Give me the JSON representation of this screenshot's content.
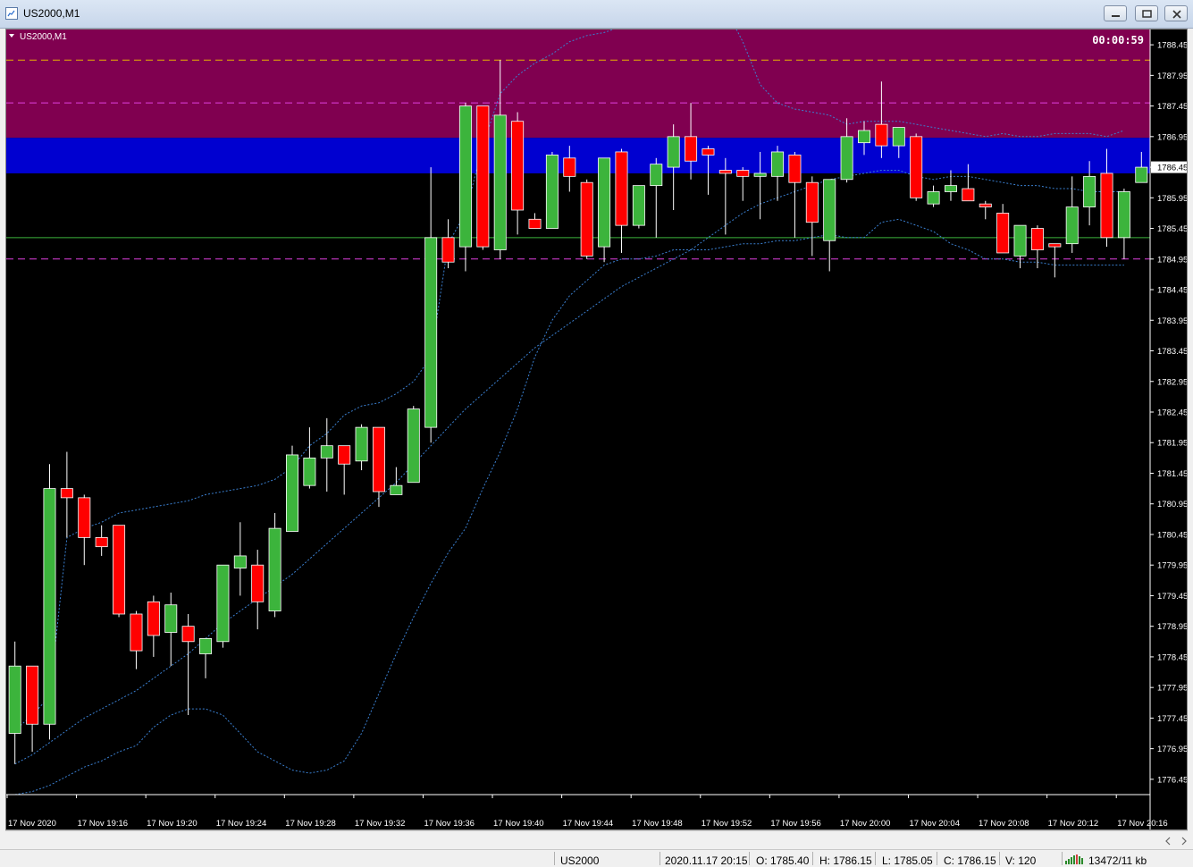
{
  "window": {
    "title": "US2000,M1"
  },
  "chart": {
    "symbol_label": "US2000,M1",
    "timer": "00:00:59",
    "current_price": "1786.45",
    "price_ticks": [
      "1788.45",
      "1787.95",
      "1787.45",
      "1786.95",
      "1786.45",
      "1785.95",
      "1785.45",
      "1784.95",
      "1784.45",
      "1783.95",
      "1783.45",
      "1782.95",
      "1782.45",
      "1781.95",
      "1781.45",
      "1780.95",
      "1780.45",
      "1779.95",
      "1779.45",
      "1778.95",
      "1778.45",
      "1777.95",
      "1777.45",
      "1776.95",
      "1776.45"
    ],
    "time_labels": [
      "17 Nov 2020",
      "17 Nov 19:16",
      "17 Nov 19:20",
      "17 Nov 19:24",
      "17 Nov 19:28",
      "17 Nov 19:32",
      "17 Nov 19:36",
      "17 Nov 19:40",
      "17 Nov 19:44",
      "17 Nov 19:48",
      "17 Nov 19:52",
      "17 Nov 19:56",
      "17 Nov 20:00",
      "17 Nov 20:04",
      "17 Nov 20:08",
      "17 Nov 20:12",
      "17 Nov 20:16"
    ],
    "colors": {
      "background": "#000000",
      "bull": "#3cb43c",
      "bear": "#ff0000",
      "zone_upper": "#800050",
      "zone_lower": "#0000d0",
      "band": "#3a7fd0",
      "text": "#ffffff"
    }
  },
  "chart_data": {
    "type": "candlestick",
    "candles": [
      [
        1777.2,
        1778.7,
        1776.7,
        1778.3
      ],
      [
        1778.3,
        1778.3,
        1776.9,
        1777.35
      ],
      [
        1777.35,
        1781.6,
        1777.1,
        1781.2
      ],
      [
        1781.2,
        1781.8,
        1780.4,
        1781.05
      ],
      [
        1781.05,
        1781.1,
        1779.95,
        1780.4
      ],
      [
        1780.4,
        1780.6,
        1780.1,
        1780.25
      ],
      [
        1780.6,
        1780.6,
        1779.1,
        1779.15
      ],
      [
        1779.15,
        1779.2,
        1778.25,
        1778.55
      ],
      [
        1779.35,
        1779.45,
        1778.45,
        1778.8
      ],
      [
        1778.85,
        1779.5,
        1778.3,
        1779.3
      ],
      [
        1778.95,
        1779.15,
        1777.5,
        1778.7
      ],
      [
        1778.5,
        1778.75,
        1778.1,
        1778.75
      ],
      [
        1778.7,
        1779.9,
        1778.6,
        1779.95
      ],
      [
        1779.9,
        1780.65,
        1779.45,
        1780.1
      ],
      [
        1779.95,
        1780.2,
        1778.9,
        1779.35
      ],
      [
        1779.2,
        1780.8,
        1779.1,
        1780.55
      ],
      [
        1780.5,
        1781.9,
        1780.5,
        1781.75
      ],
      [
        1781.25,
        1782.2,
        1781.2,
        1781.7
      ],
      [
        1781.7,
        1782.35,
        1781.15,
        1781.9
      ],
      [
        1781.9,
        1781.9,
        1781.1,
        1781.6
      ],
      [
        1781.65,
        1782.25,
        1781.5,
        1782.2
      ],
      [
        1782.2,
        1782.2,
        1780.9,
        1781.15
      ],
      [
        1781.1,
        1781.55,
        1781.1,
        1781.25
      ],
      [
        1781.3,
        1782.55,
        1781.3,
        1782.5
      ],
      [
        1782.2,
        1786.45,
        1781.95,
        1785.3
      ],
      [
        1785.3,
        1785.6,
        1784.8,
        1784.9
      ],
      [
        1785.15,
        1787.5,
        1784.75,
        1787.45
      ],
      [
        1787.45,
        1787.45,
        1785.1,
        1785.15
      ],
      [
        1785.1,
        1788.2,
        1784.95,
        1787.3
      ],
      [
        1787.2,
        1787.35,
        1785.35,
        1785.75
      ],
      [
        1785.6,
        1785.7,
        1785.45,
        1785.45
      ],
      [
        1785.45,
        1786.7,
        1785.45,
        1786.65
      ],
      [
        1786.6,
        1786.8,
        1786.05,
        1786.3
      ],
      [
        1786.2,
        1786.25,
        1784.95,
        1785.0
      ],
      [
        1785.15,
        1786.6,
        1784.9,
        1786.6
      ],
      [
        1786.7,
        1786.75,
        1785.05,
        1785.5
      ],
      [
        1785.5,
        1786.15,
        1785.45,
        1786.15
      ],
      [
        1786.15,
        1786.6,
        1785.3,
        1786.5
      ],
      [
        1786.45,
        1787.15,
        1785.75,
        1786.95
      ],
      [
        1786.95,
        1787.5,
        1786.25,
        1786.55
      ],
      [
        1786.75,
        1786.8,
        1786.0,
        1786.65
      ],
      [
        1786.4,
        1786.6,
        1785.35,
        1786.35
      ],
      [
        1786.4,
        1786.45,
        1785.9,
        1786.3
      ],
      [
        1786.3,
        1786.7,
        1785.6,
        1786.35
      ],
      [
        1786.3,
        1786.8,
        1785.9,
        1786.7
      ],
      [
        1786.65,
        1786.7,
        1785.3,
        1786.2
      ],
      [
        1786.2,
        1786.3,
        1785.0,
        1785.55
      ],
      [
        1785.25,
        1786.25,
        1784.75,
        1786.25
      ],
      [
        1786.25,
        1787.25,
        1786.2,
        1786.95
      ],
      [
        1786.85,
        1787.2,
        1786.65,
        1787.05
      ],
      [
        1787.15,
        1787.85,
        1786.6,
        1786.8
      ],
      [
        1786.8,
        1787.05,
        1786.6,
        1787.1
      ],
      [
        1786.95,
        1787.0,
        1785.9,
        1785.95
      ],
      [
        1785.85,
        1786.15,
        1785.8,
        1786.05
      ],
      [
        1786.05,
        1786.4,
        1785.9,
        1786.15
      ],
      [
        1786.1,
        1786.5,
        1785.9,
        1785.9
      ],
      [
        1785.85,
        1785.9,
        1785.6,
        1785.8
      ],
      [
        1785.7,
        1785.85,
        1785.05,
        1785.05
      ],
      [
        1785.0,
        1785.45,
        1784.8,
        1785.5
      ],
      [
        1785.45,
        1785.5,
        1784.8,
        1785.1
      ],
      [
        1785.2,
        1785.2,
        1784.65,
        1785.15
      ],
      [
        1785.2,
        1786.3,
        1785.05,
        1785.8
      ],
      [
        1785.8,
        1786.55,
        1785.5,
        1786.3
      ],
      [
        1786.35,
        1786.75,
        1785.15,
        1785.3
      ],
      [
        1785.3,
        1786.1,
        1784.95,
        1786.05
      ],
      [
        1786.2,
        1786.7,
        1786.2,
        1786.45
      ]
    ],
    "ylim": [
      1776.2,
      1788.7
    ],
    "horizontal_levels": [
      {
        "price": 1788.2,
        "style": "dashed",
        "color": "#e8b000"
      },
      {
        "price": 1787.5,
        "style": "dashed",
        "color": "#e040e0"
      },
      {
        "price": 1785.3,
        "style": "solid",
        "color": "#3cb43c"
      },
      {
        "price": 1784.95,
        "style": "dashed",
        "color": "#e040e0"
      }
    ],
    "zones": [
      {
        "from": 1786.93,
        "to": 1788.7,
        "color": "#800050"
      },
      {
        "from": 1786.35,
        "to": 1786.93,
        "color": "#0000d0"
      }
    ],
    "bands": {
      "upper": [
        1777.25,
        1777.5,
        1777.8,
        1780.4,
        1780.55,
        1780.65,
        1780.8,
        1780.85,
        1780.9,
        1780.95,
        1781.0,
        1781.1,
        1781.15,
        1781.2,
        1781.25,
        1781.35,
        1781.55,
        1781.9,
        1782.1,
        1782.4,
        1782.55,
        1782.6,
        1782.75,
        1782.95,
        1783.35,
        1785.2,
        1785.7,
        1786.8,
        1787.65,
        1787.95,
        1788.15,
        1788.3,
        1788.5,
        1788.6,
        1788.65,
        1788.75,
        1788.8,
        1788.9,
        1789.0,
        1789.05,
        1789.1,
        1789.05,
        1788.5,
        1787.8,
        1787.5,
        1787.4,
        1787.35,
        1787.3,
        1787.15,
        1787.2,
        1787.2,
        1787.2,
        1787.15,
        1787.1,
        1787.05,
        1787.0,
        1786.95,
        1787.0,
        1786.95,
        1786.95,
        1787.0,
        1787.0,
        1787.0,
        1786.95,
        1787.05
      ],
      "middle": [
        1776.7,
        1776.85,
        1777.05,
        1777.25,
        1777.45,
        1777.6,
        1777.75,
        1777.9,
        1778.1,
        1778.3,
        1778.5,
        1778.75,
        1779.0,
        1779.2,
        1779.4,
        1779.6,
        1779.8,
        1780.05,
        1780.3,
        1780.55,
        1780.8,
        1781.05,
        1781.3,
        1781.6,
        1781.9,
        1782.2,
        1782.5,
        1782.75,
        1783.0,
        1783.25,
        1783.5,
        1783.7,
        1783.9,
        1784.1,
        1784.3,
        1784.5,
        1784.65,
        1784.8,
        1784.95,
        1785.1,
        1785.3,
        1785.5,
        1785.7,
        1785.85,
        1785.95,
        1786.05,
        1786.15,
        1786.25,
        1786.3,
        1786.35,
        1786.4,
        1786.4,
        1786.3,
        1786.25,
        1786.3,
        1786.3,
        1786.25,
        1786.2,
        1786.15,
        1786.15,
        1786.1,
        1786.1,
        1786.05,
        1786.05,
        1786.05
      ],
      "lower": [
        1776.2,
        1776.25,
        1776.35,
        1776.5,
        1776.65,
        1776.75,
        1776.9,
        1777.0,
        1777.3,
        1777.5,
        1777.6,
        1777.6,
        1777.5,
        1777.2,
        1776.9,
        1776.75,
        1776.6,
        1776.55,
        1776.6,
        1776.75,
        1777.2,
        1777.85,
        1778.5,
        1779.1,
        1779.65,
        1780.15,
        1780.55,
        1781.2,
        1781.8,
        1782.5,
        1783.35,
        1783.95,
        1784.35,
        1784.6,
        1784.85,
        1784.95,
        1784.95,
        1785.0,
        1785.1,
        1785.1,
        1785.1,
        1785.15,
        1785.2,
        1785.2,
        1785.25,
        1785.25,
        1785.3,
        1785.35,
        1785.3,
        1785.3,
        1785.55,
        1785.6,
        1785.5,
        1785.4,
        1785.2,
        1785.1,
        1784.95,
        1784.95,
        1784.9,
        1784.9,
        1784.85,
        1784.85,
        1784.85,
        1784.85,
        1784.85
      ]
    }
  },
  "statusbar": {
    "symbol": "US2000",
    "datetime": "2020.11.17 20:15",
    "open": "O: 1785.40",
    "high": "H: 1786.15",
    "low": "L: 1785.05",
    "close": "C: 1786.15",
    "volume": "V: 120",
    "traffic": "13472/11 kb"
  }
}
